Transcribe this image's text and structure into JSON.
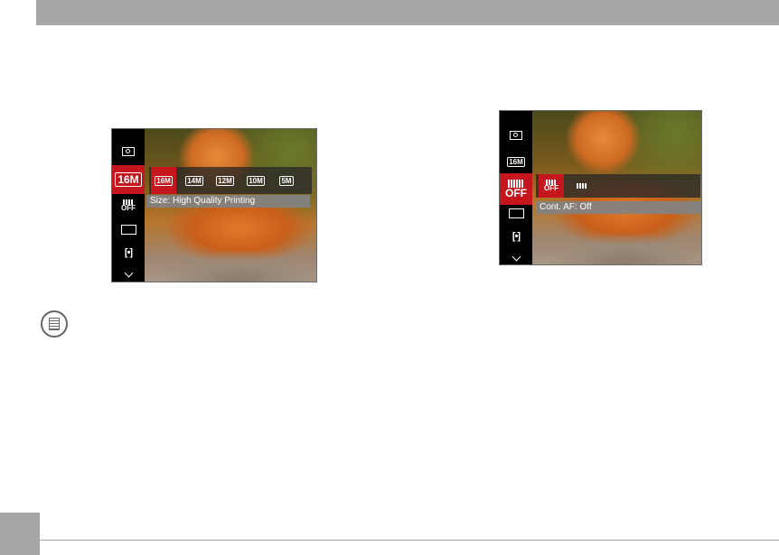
{
  "screen1": {
    "sidebar": [
      "metering-icon",
      "image-size-icon",
      "cont-af-icon",
      "capture-mode-icon",
      "focus-icon",
      "more-icon"
    ],
    "sidebar_active_label": "16M",
    "options": [
      "16M",
      "14M",
      "12M",
      "10M",
      "5M"
    ],
    "selected_option": "16M",
    "caption": "Size: High Quality Printing"
  },
  "screen2": {
    "sidebar_label_size": "16M",
    "active_label": "OFF",
    "options": [
      "OFF",
      ""
    ],
    "caption": "Cont. AF: Off"
  },
  "colors": {
    "accent": "#c4161c",
    "header": "#a7a7a7"
  }
}
